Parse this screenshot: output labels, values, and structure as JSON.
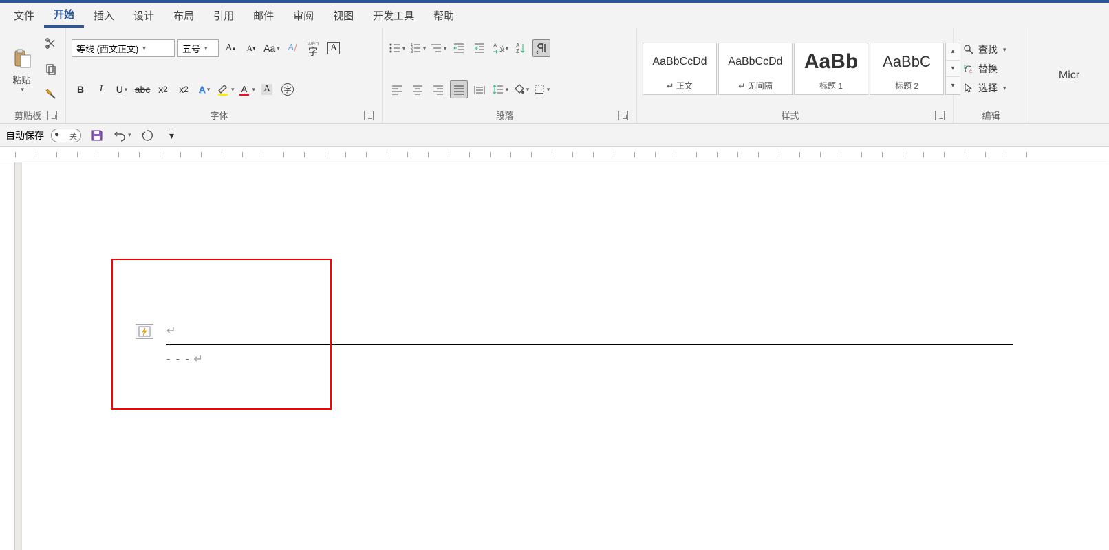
{
  "tabs": [
    "文件",
    "开始",
    "插入",
    "设计",
    "布局",
    "引用",
    "邮件",
    "审阅",
    "视图",
    "开发工具",
    "帮助"
  ],
  "active_tab": "开始",
  "clipboard": {
    "paste": "粘贴",
    "group": "剪贴板"
  },
  "font": {
    "family": "等线 (西文正文)",
    "size": "五号",
    "group": "字体",
    "wen": "wén",
    "zi": "字"
  },
  "paragraph": {
    "group": "段落"
  },
  "styles": {
    "group": "样式",
    "items": [
      {
        "preview": "AaBbCcDd",
        "label": "正文",
        "size": "16px"
      },
      {
        "preview": "AaBbCcDd",
        "label": "无间隔",
        "size": "16px"
      },
      {
        "preview": "AaBb",
        "label": "标题 1",
        "size": "30px"
      },
      {
        "preview": "AaBbC",
        "label": "标题 2",
        "size": "22px"
      }
    ]
  },
  "editing": {
    "find": "查找",
    "replace": "替换",
    "select": "选择",
    "group": "编辑"
  },
  "right_cut": "Micr",
  "qat": {
    "autosave": "自动保存",
    "toggle": "关"
  },
  "doc": {
    "dashes": "- - -"
  }
}
